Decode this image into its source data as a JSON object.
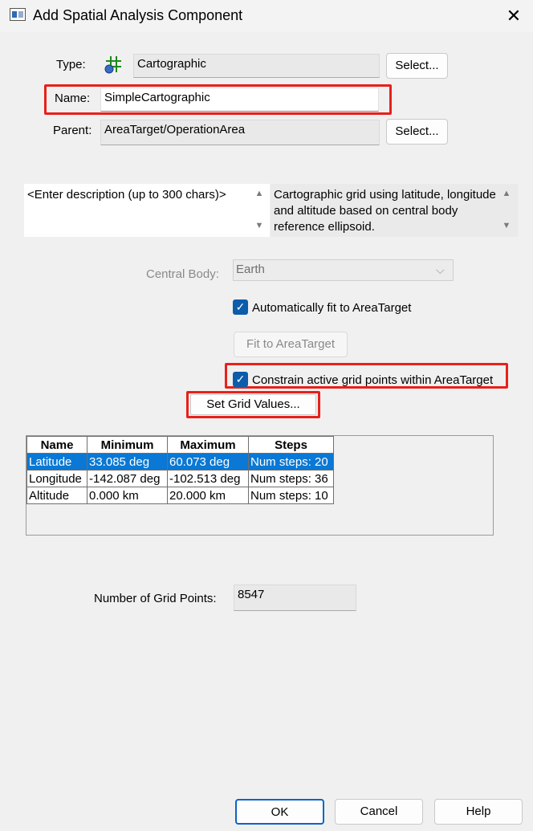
{
  "window": {
    "title": "Add Spatial Analysis Component"
  },
  "type": {
    "label": "Type:",
    "value": "Cartographic",
    "icon": "cartographic-grid-icon",
    "select_label": "Select..."
  },
  "name": {
    "label": "Name:",
    "value": "SimpleCartographic"
  },
  "parent": {
    "label": "Parent:",
    "value": "AreaTarget/OperationArea",
    "select_label": "Select..."
  },
  "description": {
    "user_text": "<Enter description (up to 300 chars)>",
    "type_description": "Cartographic grid using latitude, longitude and altitude based on central body reference ellipsoid."
  },
  "central_body": {
    "label": "Central Body:",
    "value": "Earth"
  },
  "auto_fit": {
    "label": "Automatically fit to AreaTarget",
    "checked": true
  },
  "fit_button": "Fit to AreaTarget",
  "constrain": {
    "label": "Constrain active grid points within AreaTarget",
    "checked": true
  },
  "set_grid_button": "Set Grid Values...",
  "grid_table": {
    "headers": [
      "Name",
      "Minimum",
      "Maximum",
      "Steps"
    ],
    "rows": [
      [
        "Latitude",
        "33.085 deg",
        "60.073 deg",
        "Num steps: 20"
      ],
      [
        "Longitude",
        "-142.087 deg",
        "-102.513 deg",
        "Num steps: 36"
      ],
      [
        "Altitude",
        "0.000 km",
        "20.000 km",
        "Num steps: 10"
      ]
    ],
    "selected_row": 0
  },
  "grid_points": {
    "label": "Number of Grid Points:",
    "value": "8547"
  },
  "footer": {
    "ok": "OK",
    "cancel": "Cancel",
    "help": "Help"
  },
  "colors": {
    "highlight": "#e8201a",
    "selection": "#0a78d4",
    "checkbox": "#0b5cab"
  }
}
